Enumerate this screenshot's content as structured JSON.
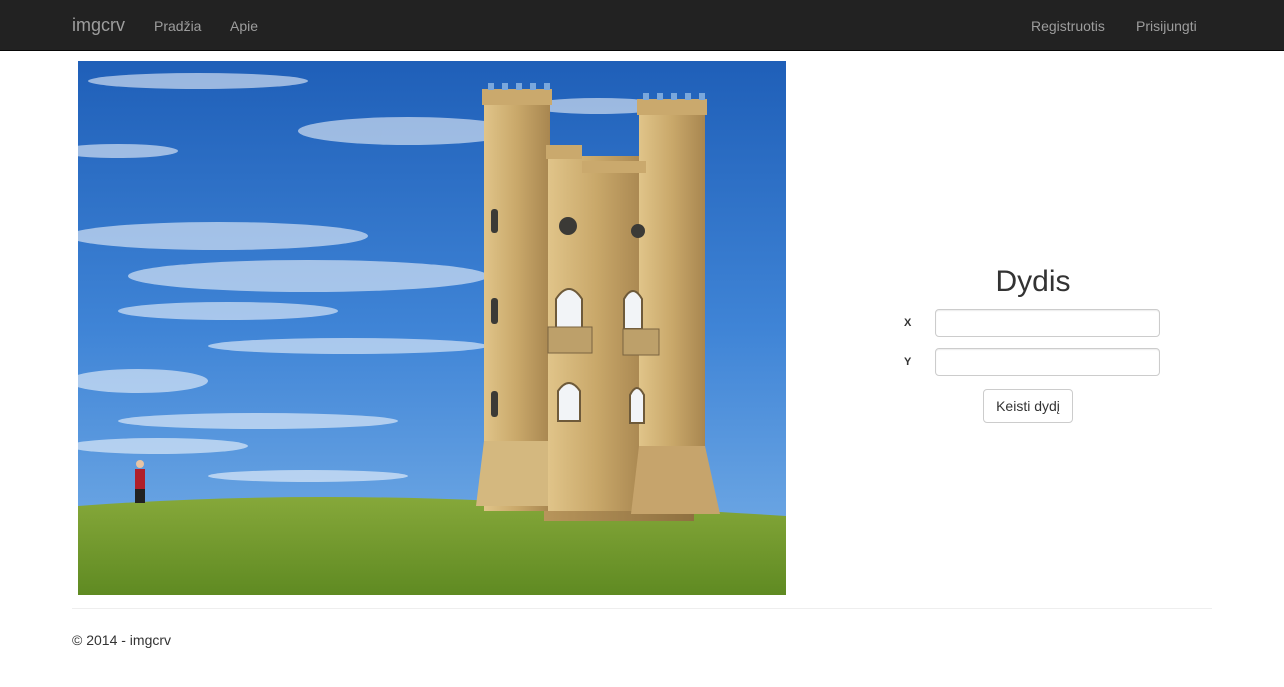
{
  "navbar": {
    "brand": "imgcrv",
    "left_links": [
      "Pradžia",
      "Apie"
    ],
    "right_links": [
      "Registruotis",
      "Prisijungti"
    ],
    "background": "#222222",
    "link_color": "#9d9d9d"
  },
  "image": {
    "subject": "castle-tower-photo"
  },
  "resize_form": {
    "title": "Dydis",
    "x_label": "X",
    "x_value": "",
    "y_label": "Y",
    "y_value": "",
    "submit_label": "Keisti dydį"
  },
  "footer": {
    "text": "© 2014 - imgcrv"
  }
}
